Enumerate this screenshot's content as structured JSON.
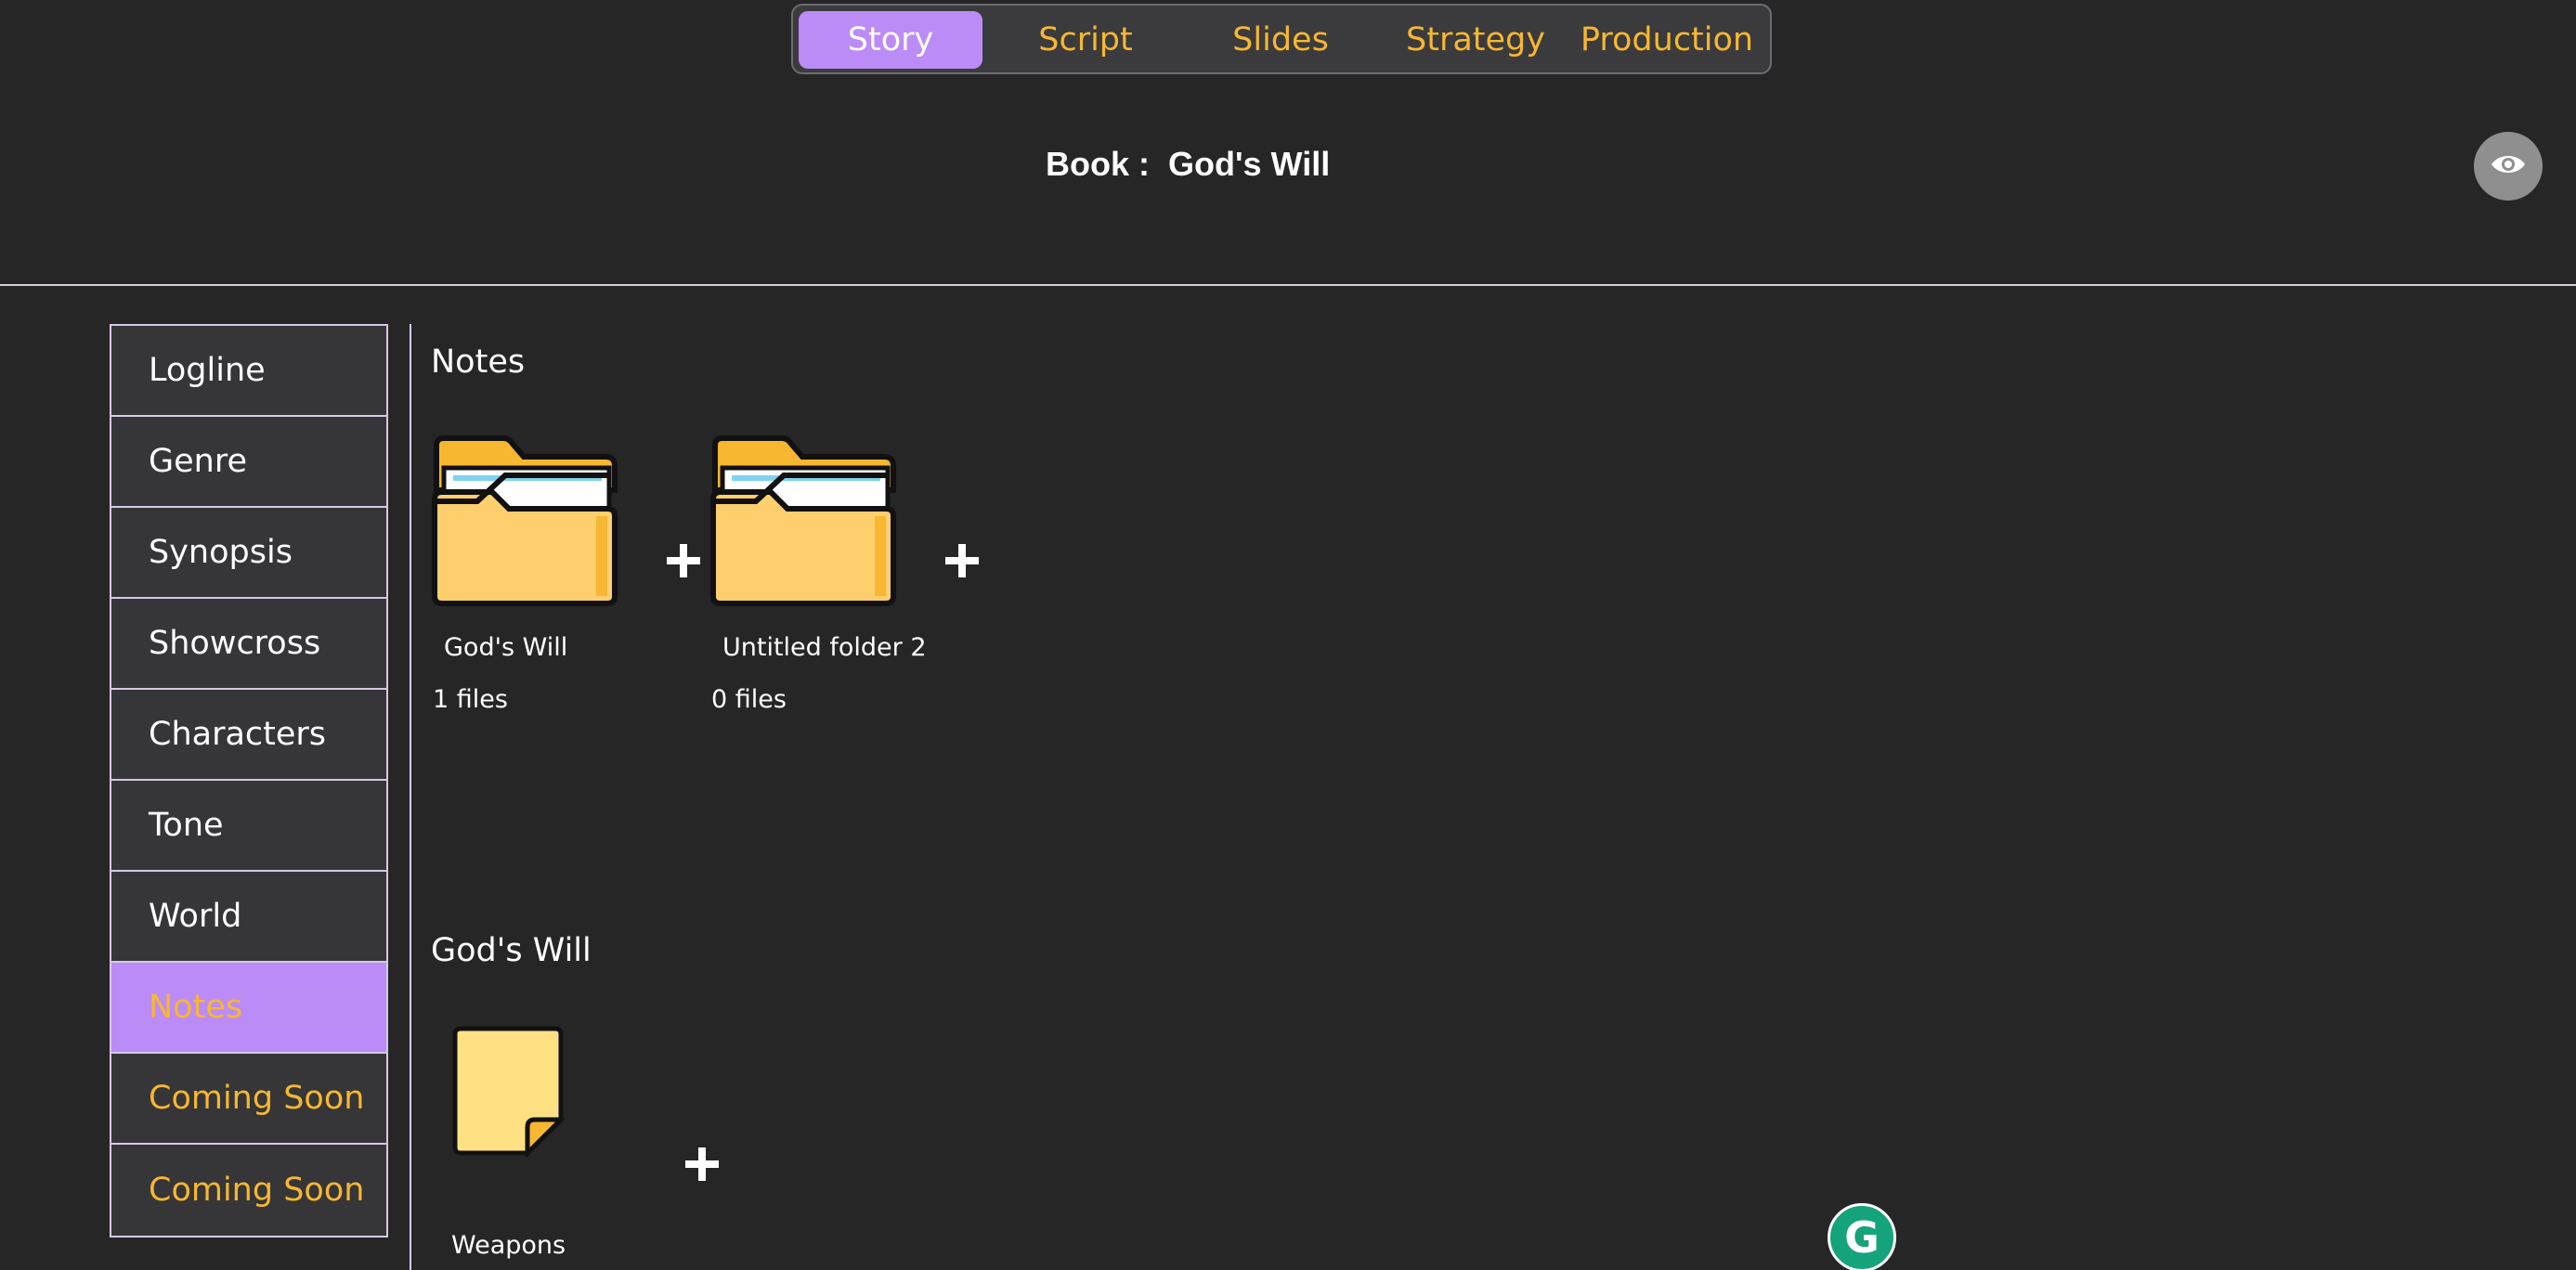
{
  "tabs": [
    {
      "label": "Story",
      "active": true
    },
    {
      "label": "Script",
      "active": false
    },
    {
      "label": "Slides",
      "active": false
    },
    {
      "label": "Strategy",
      "active": false
    },
    {
      "label": "Production",
      "active": false
    }
  ],
  "header": {
    "book_label": "Book :  God's Will",
    "view_icon": "eye-icon"
  },
  "sidebar": {
    "items": [
      {
        "label": "Logline"
      },
      {
        "label": "Genre"
      },
      {
        "label": "Synopsis"
      },
      {
        "label": "Showcross"
      },
      {
        "label": "Characters"
      },
      {
        "label": "Tone"
      },
      {
        "label": "World"
      },
      {
        "label": "Notes",
        "active": true
      },
      {
        "label": "Coming Soon"
      },
      {
        "label": "Coming Soon"
      }
    ]
  },
  "notes_section": {
    "title": "Notes",
    "folders": [
      {
        "name": "God's Will",
        "count": "1 files"
      },
      {
        "name": "Untitled folder 2",
        "count": "0 files"
      }
    ]
  },
  "folder_section": {
    "title": "God's Will",
    "notes": [
      {
        "name": "Weapons"
      }
    ]
  },
  "colors": {
    "accent_purple": "#bb8cf7",
    "accent_orange": "#f7b731",
    "background": "#262627"
  },
  "grammarly": {
    "letter": "G"
  }
}
